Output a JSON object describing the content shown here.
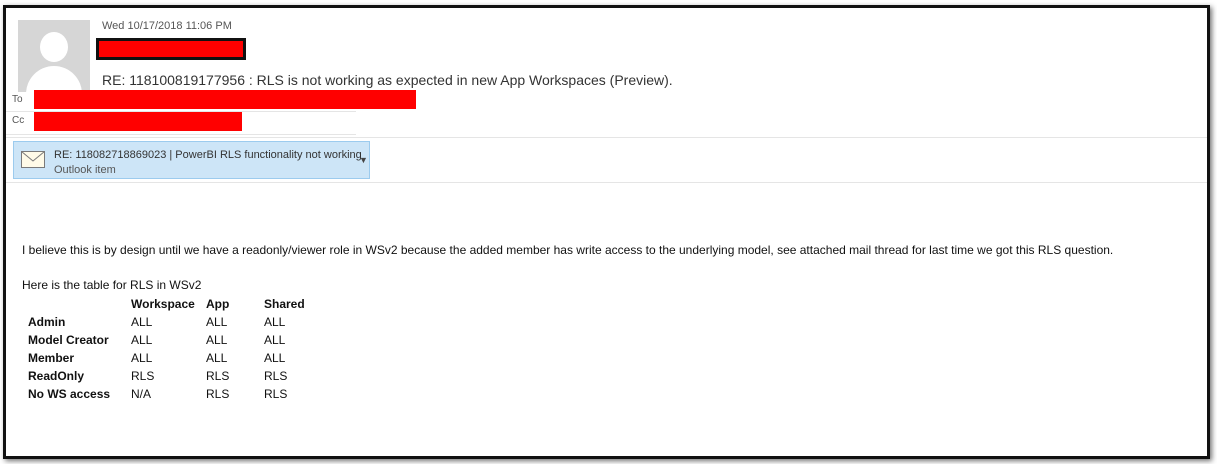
{
  "email": {
    "date": "Wed 10/17/2018 11:06 PM",
    "subject": "RE: 118100819177956 : RLS is not working as expected in new App Workspaces (Preview).",
    "to_label": "To",
    "cc_label": "Cc"
  },
  "attachment": {
    "title": "RE: 118082718869023 |  PowerBI RLS functionality not working",
    "subtitle": "Outlook item",
    "icon": "envelope-icon"
  },
  "body": {
    "paragraph": "I believe this is by design until we have a readonly/viewer role in WSv2 because the added member has write access to the underlying model, see attached mail thread for last time we got this RLS question.",
    "table_intro": "Here is the table for RLS in WSv2",
    "table": {
      "headers": [
        "",
        "Workspace",
        "App",
        "Shared"
      ],
      "rows": [
        [
          "Admin",
          "ALL",
          "ALL",
          "ALL"
        ],
        [
          "Model Creator",
          "ALL",
          "ALL",
          "ALL"
        ],
        [
          "Member",
          "ALL",
          "ALL",
          "ALL"
        ],
        [
          "ReadOnly",
          "RLS",
          "RLS",
          "RLS"
        ],
        [
          "No WS access",
          "N/A",
          "RLS",
          "RLS"
        ]
      ]
    }
  },
  "colors": {
    "redaction": "#ff0000",
    "attachment_bg": "#cde5f7"
  }
}
